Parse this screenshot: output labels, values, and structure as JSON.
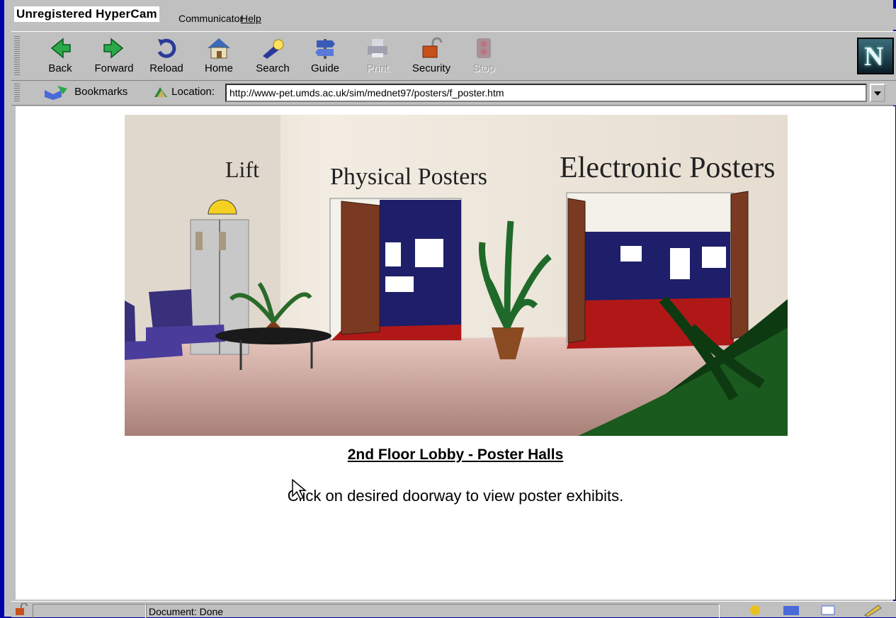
{
  "watermark": "Unregistered HyperCam",
  "menu": {
    "communicator": "Communicator",
    "help": "Help"
  },
  "toolbar": {
    "buttons": [
      {
        "label": "Back",
        "icon": "back-arrow-icon"
      },
      {
        "label": "Forward",
        "icon": "forward-arrow-icon"
      },
      {
        "label": "Reload",
        "icon": "reload-icon"
      },
      {
        "label": "Home",
        "icon": "home-icon"
      },
      {
        "label": "Search",
        "icon": "search-flashlight-icon"
      },
      {
        "label": "Guide",
        "icon": "guide-signpost-icon"
      },
      {
        "label": "Print",
        "icon": "print-icon",
        "disabled": true
      },
      {
        "label": "Security",
        "icon": "padlock-icon"
      },
      {
        "label": "Stop",
        "icon": "stop-icon",
        "disabled": true
      }
    ],
    "logo": "N"
  },
  "location": {
    "bookmarks_label": "Bookmarks",
    "location_label": "Location:",
    "url": "http://www-pet.umds.ac.uk/sim/mednet97/posters/f_poster.htm"
  },
  "scene": {
    "lift_sign": "Lift",
    "physical_sign": "Physical Posters",
    "electronic_sign": "Electronic Posters"
  },
  "page": {
    "caption": "2nd Floor Lobby - Poster Halls",
    "instruction": "Click on desired doorway to view poster exhibits."
  },
  "status": {
    "text": "Document: Done"
  },
  "colors": {
    "titlebar": "#0000a8",
    "chrome": "#c0c0c0",
    "carpet": "#b01818",
    "door": "#7a3a22"
  }
}
